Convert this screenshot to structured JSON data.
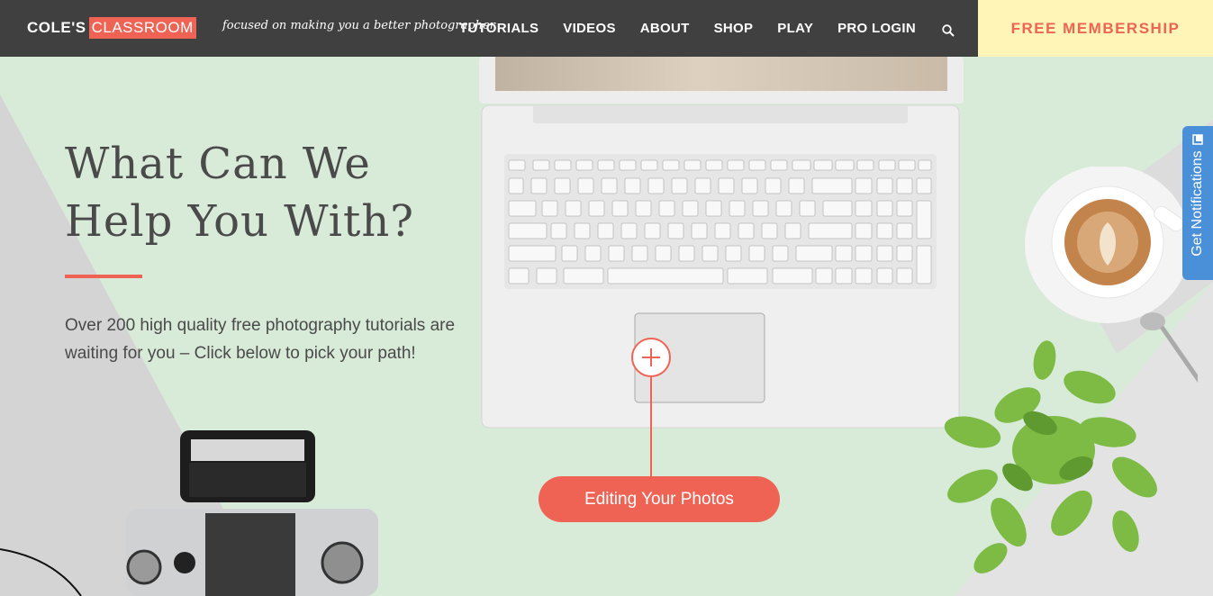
{
  "header": {
    "logo_cole": "COLE'S",
    "logo_classroom": "CLASSROOM",
    "tagline": "focused on making you a better photographer",
    "nav": [
      "TUTORIALS",
      "VIDEOS",
      "ABOUT",
      "SHOP",
      "PLAY",
      "PRO LOGIN"
    ],
    "search_icon": "search-icon",
    "membership_label": "FREE MEMBERSHIP"
  },
  "hero": {
    "headline_line1": "What Can We",
    "headline_line2": "Help You With?",
    "description": "Over 200 high quality free photography tutorials are waiting for you – Click below to pick your path!"
  },
  "hotspot": {
    "icon": "plus-icon",
    "cta_label": "Editing Your Photos"
  },
  "notification_tab": {
    "label": "Get Notifications",
    "icon": "bell-icon"
  },
  "colors": {
    "accent": "#ef6354",
    "header_bg": "#404040",
    "membership_bg": "#fef5b7",
    "hero_bg": "#d8ead8",
    "notification_bg": "#4a90d9",
    "text": "#4a4a4a"
  }
}
